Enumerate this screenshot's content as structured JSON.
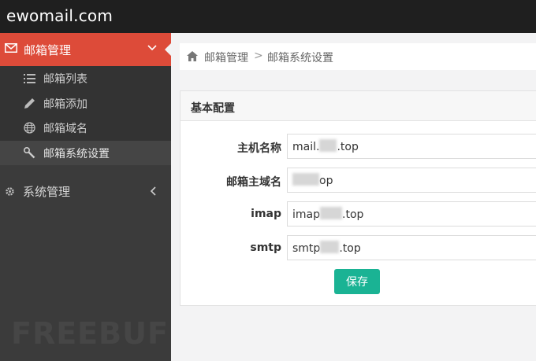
{
  "topbar": {
    "brand": "ewomail.com"
  },
  "sidebar": {
    "active_menu": {
      "label": "邮箱管理",
      "icon": "envelope-icon"
    },
    "submenu": [
      {
        "label": "邮箱列表",
        "icon": "list-icon"
      },
      {
        "label": "邮箱添加",
        "icon": "pencil-icon"
      },
      {
        "label": "邮箱域名",
        "icon": "globe-icon"
      },
      {
        "label": "邮箱系统设置",
        "icon": "wrench-icon",
        "selected": true
      }
    ],
    "menu2": {
      "label": "系统管理",
      "icon": "gear-icon"
    },
    "watermark": "FREEBUF"
  },
  "breadcrumb": {
    "home_icon": "home-icon",
    "level1": "邮箱管理",
    "separator": ">",
    "level2": "邮箱系统设置"
  },
  "panel": {
    "title": "基本配置",
    "fields": [
      {
        "label": "主机名称",
        "value_prefix": "mail.",
        "value_suffix": ".top"
      },
      {
        "label": "邮箱主域名",
        "value_prefix": "",
        "value_suffix": "op"
      },
      {
        "label": "imap",
        "value_prefix": "imap",
        "value_suffix": ".top"
      },
      {
        "label": "smtp",
        "value_prefix": "smtp",
        "value_suffix": ".top"
      }
    ],
    "save_label": "保存"
  },
  "colors": {
    "accent_red": "#dd4b39",
    "button_green": "#1ab394",
    "topbar": "#1f1f1f",
    "sidebar": "#3b3b3b"
  }
}
